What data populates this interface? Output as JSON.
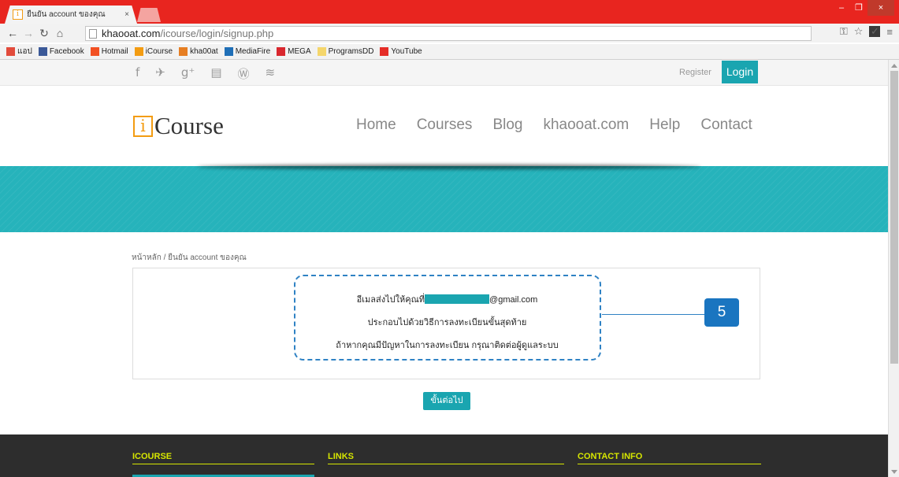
{
  "browser": {
    "tab_title": "ยืนยัน account ของคุณ",
    "tab_close": "×",
    "url_host": "khaooat.com",
    "url_path": "/icourse/login/signup.php",
    "window_controls": [
      "–",
      "❐",
      "×"
    ]
  },
  "bookmarks": [
    {
      "label": "แอป",
      "icon": "apps-icon",
      "color": "#e24b3b"
    },
    {
      "label": "Facebook",
      "icon": "facebook-icon",
      "color": "#3b5998"
    },
    {
      "label": "Hotmail",
      "icon": "hotmail-icon",
      "color": "#f25022"
    },
    {
      "label": "iCourse",
      "icon": "icourse-icon",
      "color": "#f39c12"
    },
    {
      "label": "kha00at",
      "icon": "kha00at-icon",
      "color": "#e67e22"
    },
    {
      "label": "MediaFire",
      "icon": "mediafire-icon",
      "color": "#1f6fb7"
    },
    {
      "label": "MEGA",
      "icon": "mega-icon",
      "color": "#d9272e"
    },
    {
      "label": "ProgramsDD",
      "icon": "programsdd-icon",
      "color": "#f5d66b"
    },
    {
      "label": "YouTube",
      "icon": "youtube-icon",
      "color": "#e52d27"
    }
  ],
  "topbar": {
    "register": "Register",
    "login": "Login"
  },
  "logo": {
    "mark": "i",
    "text": "Course"
  },
  "nav": [
    "Home",
    "Courses",
    "Blog",
    "khaooat.com",
    "Help",
    "Contact"
  ],
  "breadcrumb": "หน้าหลัก / ยืนยัน account ของคุณ",
  "message": {
    "line1_prefix": "อีเมลส่งไปให้คุณที่",
    "line1_suffix": "@gmail.com",
    "line2": "ประกอบไปด้วยวิธีการลงทะเบียนขั้นสุดท้าย",
    "line3": "ถ้าหากคุณมีปัญหาในการลงทะเบียน กรุณาติดต่อผู้ดูแลระบบ"
  },
  "annotation": {
    "number": "5"
  },
  "next_button": "ขั้นต่อไป",
  "footer": {
    "col1": "ICOURSE",
    "col2": "LINKS",
    "col3": "CONTACT INFO"
  },
  "colors": {
    "accent": "#1aa5b0",
    "chrome": "#e8251f",
    "annotation": "#1a75c0",
    "footer_heading": "#d6e600"
  }
}
